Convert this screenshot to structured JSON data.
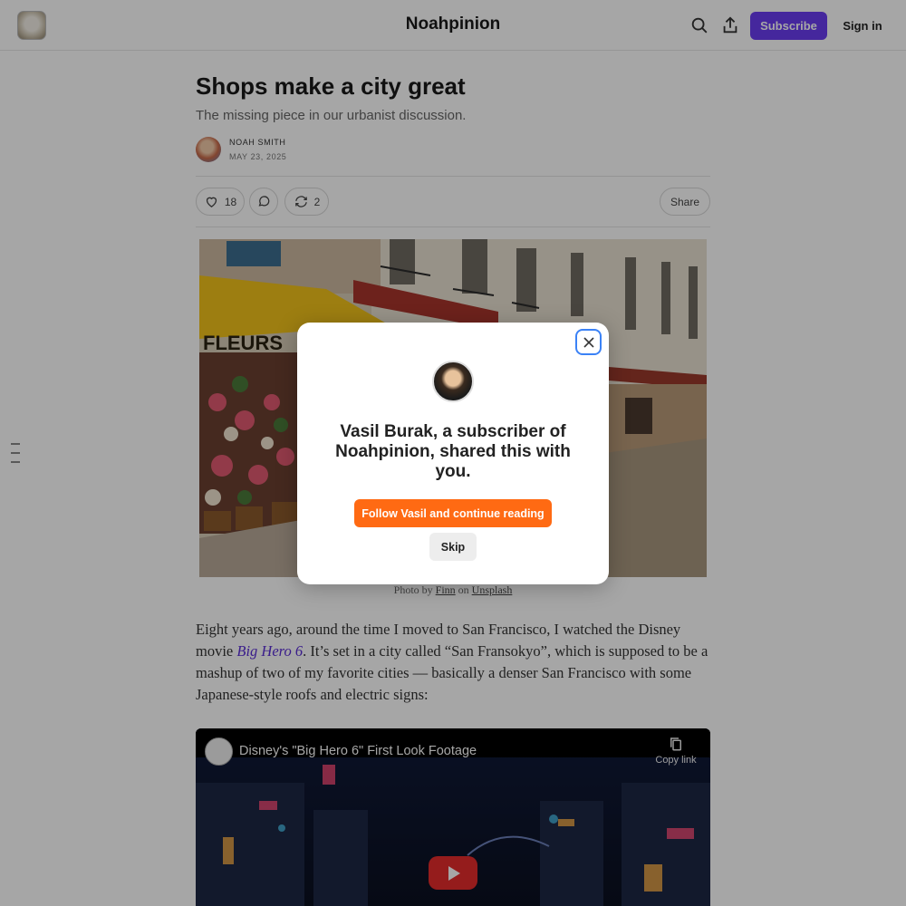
{
  "header": {
    "publication_name": "Noahpinion",
    "subscribe_label": "Subscribe",
    "signin_label": "Sign in"
  },
  "article": {
    "title": "Shops make a city great",
    "subtitle": "The missing piece in our urbanist discussion.",
    "author": "NOAH SMITH",
    "date": "MAY 23, 2025",
    "likes": "18",
    "restacks": "2",
    "share_label": "Share",
    "hero_sign_text": "FLEURS",
    "caption": {
      "prefix": "Photo by",
      "photographer": "Finn",
      "middle": "on",
      "source": "Unsplash"
    },
    "paragraph": {
      "part1": "Eight years ago, around the time I moved to San Francisco, I watched the Disney movie ",
      "link": "Big Hero 6",
      "part2": ". It’s set in a city called “San Fransokyo”, which is supposed to be a mashup of two of my favorite cities — basically a denser San Francisco with some Japanese-style roofs and electric signs:"
    }
  },
  "video": {
    "title": "Disney's \"Big Hero 6\" First Look Footage",
    "copy_link_label": "Copy link"
  },
  "modal": {
    "heading": "Vasil Burak, a subscriber of Noahpinion, shared this with you.",
    "follow_label": "Follow Vasil and continue reading",
    "skip_label": "Skip"
  },
  "colors": {
    "subscribe_bg": "#6b3df2",
    "follow_bg": "#ff6a13",
    "link": "#5a2dd6"
  }
}
